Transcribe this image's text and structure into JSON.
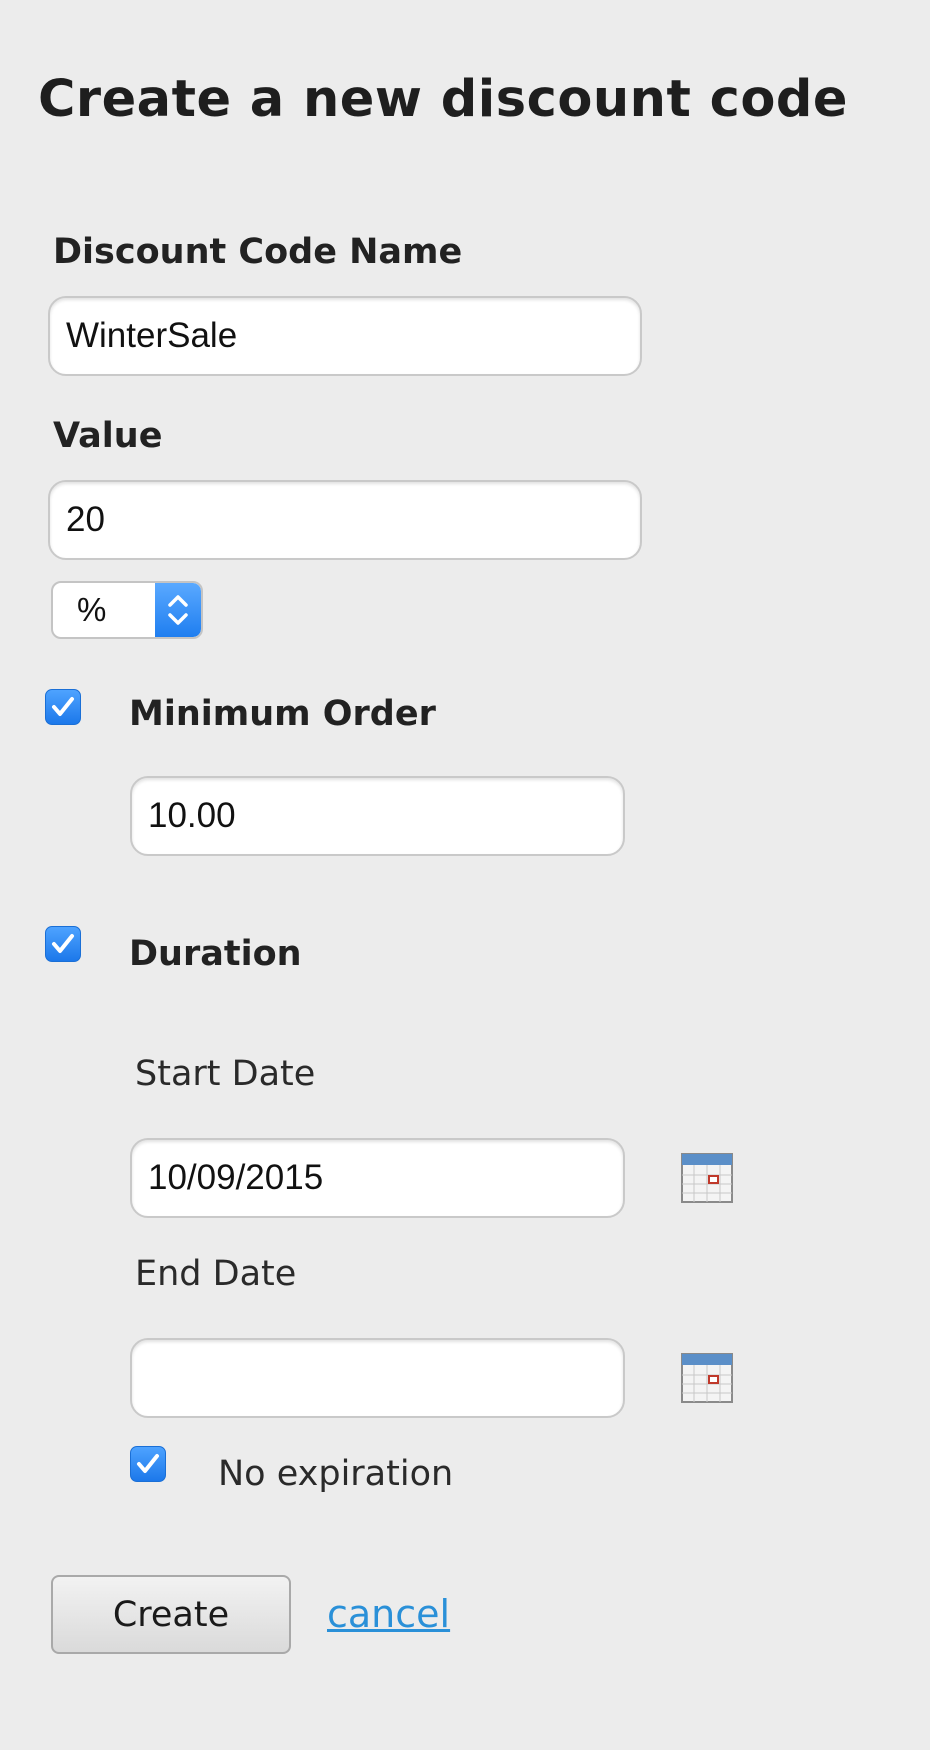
{
  "page": {
    "title": "Create a new discount code"
  },
  "form": {
    "name_label": "Discount Code Name",
    "name_value": "WinterSale",
    "value_label": "Value",
    "value_value": "20",
    "unit_selected": "%",
    "minimum_order": {
      "checked": true,
      "label": "Minimum Order",
      "value": "10.00"
    },
    "duration": {
      "checked": true,
      "label": "Duration",
      "start_label": "Start Date",
      "start_value": "10/09/2015",
      "end_label": "End Date",
      "end_value": "",
      "no_expiration_checked": true,
      "no_expiration_label": "No expiration"
    },
    "create_label": "Create",
    "cancel_label": "cancel"
  },
  "icons": {
    "checkbox": "checkmark-icon",
    "select": "chevron-up-down-icon",
    "date_picker": "calendar-icon"
  },
  "colors": {
    "background": "#ececec",
    "checkbox_blue": "#1c78ea",
    "link": "#2a90d8",
    "calendar_header": "#5b8fc8",
    "calendar_mark": "#c0392b"
  }
}
